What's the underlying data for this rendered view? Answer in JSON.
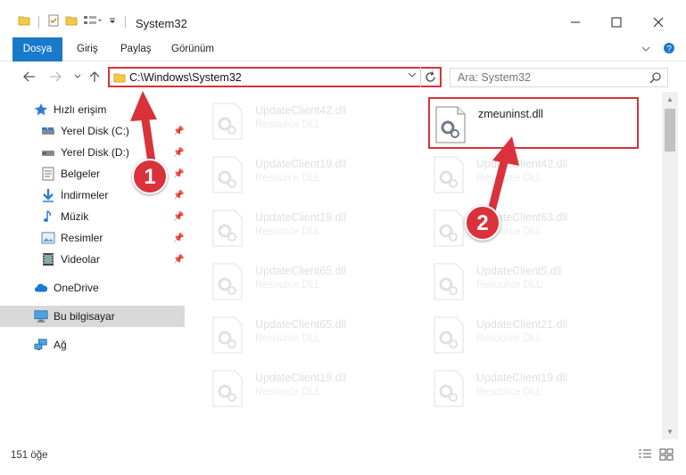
{
  "window": {
    "title": "System32",
    "controls": {
      "minimize": "—",
      "maximize": "☐",
      "close": "✕"
    }
  },
  "ribbon": {
    "tabs": [
      "Dosya",
      "Giriş",
      "Paylaş",
      "Görünüm"
    ]
  },
  "address": {
    "path": "C:\\Windows\\System32"
  },
  "search": {
    "placeholder": "Ara: System32"
  },
  "navpane": {
    "items": [
      {
        "label": "Hızlı erişim",
        "icon": "star-icon"
      },
      {
        "label": "Yerel Disk (C:)",
        "icon": "drive-icon",
        "pinned": true
      },
      {
        "label": "Yerel Disk (D:)",
        "icon": "drive-icon",
        "pinned": true
      },
      {
        "label": "Belgeler",
        "icon": "documents-icon",
        "pinned": true
      },
      {
        "label": "İndirmeler",
        "icon": "download-icon",
        "pinned": true
      },
      {
        "label": "Müzik",
        "icon": "music-icon",
        "pinned": true
      },
      {
        "label": "Resimler",
        "icon": "pictures-icon",
        "pinned": true
      },
      {
        "label": "Videolar",
        "icon": "video-icon",
        "pinned": true
      },
      {
        "label": "OneDrive",
        "icon": "cloud-icon"
      },
      {
        "label": "Bu bilgisayar",
        "icon": "computer-icon",
        "selected": true
      },
      {
        "label": "Ağ",
        "icon": "network-icon"
      }
    ]
  },
  "files": {
    "left": [
      {
        "name": "UpdateClient42.dll",
        "type": "Resource DLL"
      },
      {
        "name": "UpdateClient19.dll",
        "type": "Resource DLL"
      },
      {
        "name": "UpdateClient19.dll",
        "type": "Resource DLL"
      },
      {
        "name": "UpdateClient65.dll",
        "type": "Resource DLL"
      },
      {
        "name": "UpdateClient65.dll",
        "type": "Resource DLL"
      },
      {
        "name": "UpdateClient19.dll",
        "type": "Resource DLL"
      }
    ],
    "right": [
      {
        "name": "zmeuninst.dll",
        "type": "",
        "highlighted": true
      },
      {
        "name": "UpdateClient42.dll",
        "type": "Resource DLL"
      },
      {
        "name": "UpdateClient63.dll",
        "type": "Resource DLL"
      },
      {
        "name": "UpdateClient5.dll",
        "type": "Resource DLL"
      },
      {
        "name": "UpdateClient21.dll",
        "type": "Resource DLL"
      },
      {
        "name": "UpdateClient19.dll",
        "type": "Resource DLL"
      }
    ]
  },
  "status": {
    "count": "151 öğe"
  },
  "annotations": {
    "badge1": "1",
    "badge2": "2",
    "color": "#d9323a"
  }
}
